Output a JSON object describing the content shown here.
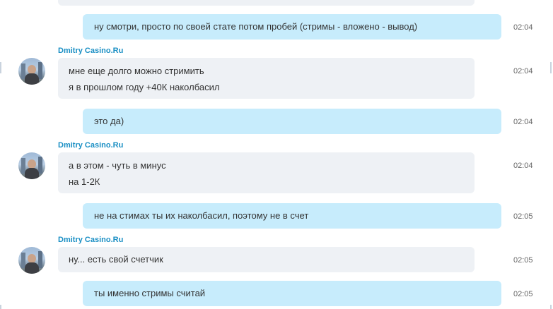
{
  "conversation": {
    "contact_name": "Dmitry Casino.Ru",
    "messages": [
      {
        "direction": "outgoing",
        "lines": [
          "ну смотри, просто по своей стате потом пробей (стримы - вложено - вывод)"
        ],
        "time": "02:04"
      },
      {
        "direction": "incoming",
        "lines": [
          "мне еще долго можно стримить",
          "я в прошлом году +40К наколбасил"
        ],
        "time": "02:04"
      },
      {
        "direction": "outgoing",
        "lines": [
          "это да)"
        ],
        "time": "02:04"
      },
      {
        "direction": "incoming",
        "lines": [
          "а в этом - чуть в минус",
          "на 1-2К"
        ],
        "time": "02:04"
      },
      {
        "direction": "outgoing",
        "lines": [
          "не на стимах ты их наколбасил, поэтому не в счет"
        ],
        "time": "02:05"
      },
      {
        "direction": "incoming",
        "lines": [
          "ну... есть свой счетчик"
        ],
        "time": "02:05"
      },
      {
        "direction": "outgoing",
        "lines": [
          "ты именно стримы считай"
        ],
        "time": "02:05"
      }
    ]
  },
  "colors": {
    "incoming_bubble": "#eef1f5",
    "outgoing_bubble": "#c7ecfc",
    "sender_name": "#1a8fc4",
    "timestamp": "#666666"
  }
}
